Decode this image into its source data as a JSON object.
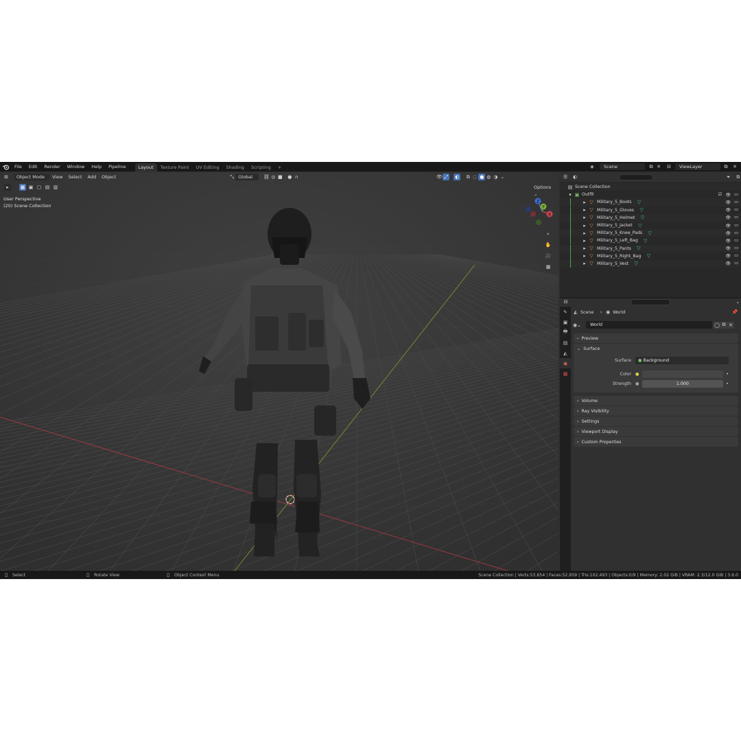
{
  "menu": {
    "items": [
      "File",
      "Edit",
      "Render",
      "Window",
      "Help",
      "Pipeline"
    ],
    "workspaces": [
      "Layout",
      "Texture Paint",
      "UV Editing",
      "Shading",
      "Scripting"
    ],
    "add_tab": "+",
    "scene_name": "Scene",
    "view_layer": "ViewLayer"
  },
  "viewport": {
    "mode": "Object Mode",
    "menus": [
      "View",
      "Select",
      "Add",
      "Object"
    ],
    "transform_orientation": "Global",
    "options_label": "Options",
    "view_name": "User Perspective",
    "collection_label": "(20) Scene Collection",
    "gizmo": {
      "x": "X",
      "y": "Y",
      "z": "Z"
    }
  },
  "outliner": {
    "root": "Scene Collection",
    "collection": "Outfit",
    "objects": [
      "Military_5_Boots",
      "Military_5_Gloves",
      "Military_5_Helmet",
      "Military_5_Jacket",
      "Military_5_Knee_Pads",
      "Military_5_Left_Bag",
      "Military_5_Pants",
      "Military_5_Right_Bag",
      "Military_5_Vest"
    ]
  },
  "properties": {
    "breadcrumb_scene": "Scene",
    "breadcrumb_world": "World",
    "world_name": "World",
    "panels": {
      "preview": "Preview",
      "surface": "Surface",
      "volume": "Volume",
      "ray_visibility": "Ray Visibility",
      "settings": "Settings",
      "viewport_display": "Viewport Display",
      "custom_properties": "Custom Properties"
    },
    "surface_label": "Surface",
    "surface_value": "Background",
    "color_label": "Color",
    "strength_label": "Strength",
    "strength_value": "1.000"
  },
  "statusbar": {
    "select": "Select",
    "rotate": "Rotate View",
    "context_menu": "Object Context Menu",
    "stats": "Scene Collection | Verts:53,654 | Faces:52,959 | Tris:102,493 | Objects:0/9 | Memory: 2.02 GiB | VRAM: 2.3/12.0 GiB | 3.6.0"
  },
  "colors": {
    "accent": "#4772b3",
    "x_axis": "#c9464e",
    "y_axis": "#7faa3a",
    "z_axis": "#3f6fd1",
    "mesh_icon": "#e38a3a",
    "modifier_icon": "#4bc0a0"
  }
}
